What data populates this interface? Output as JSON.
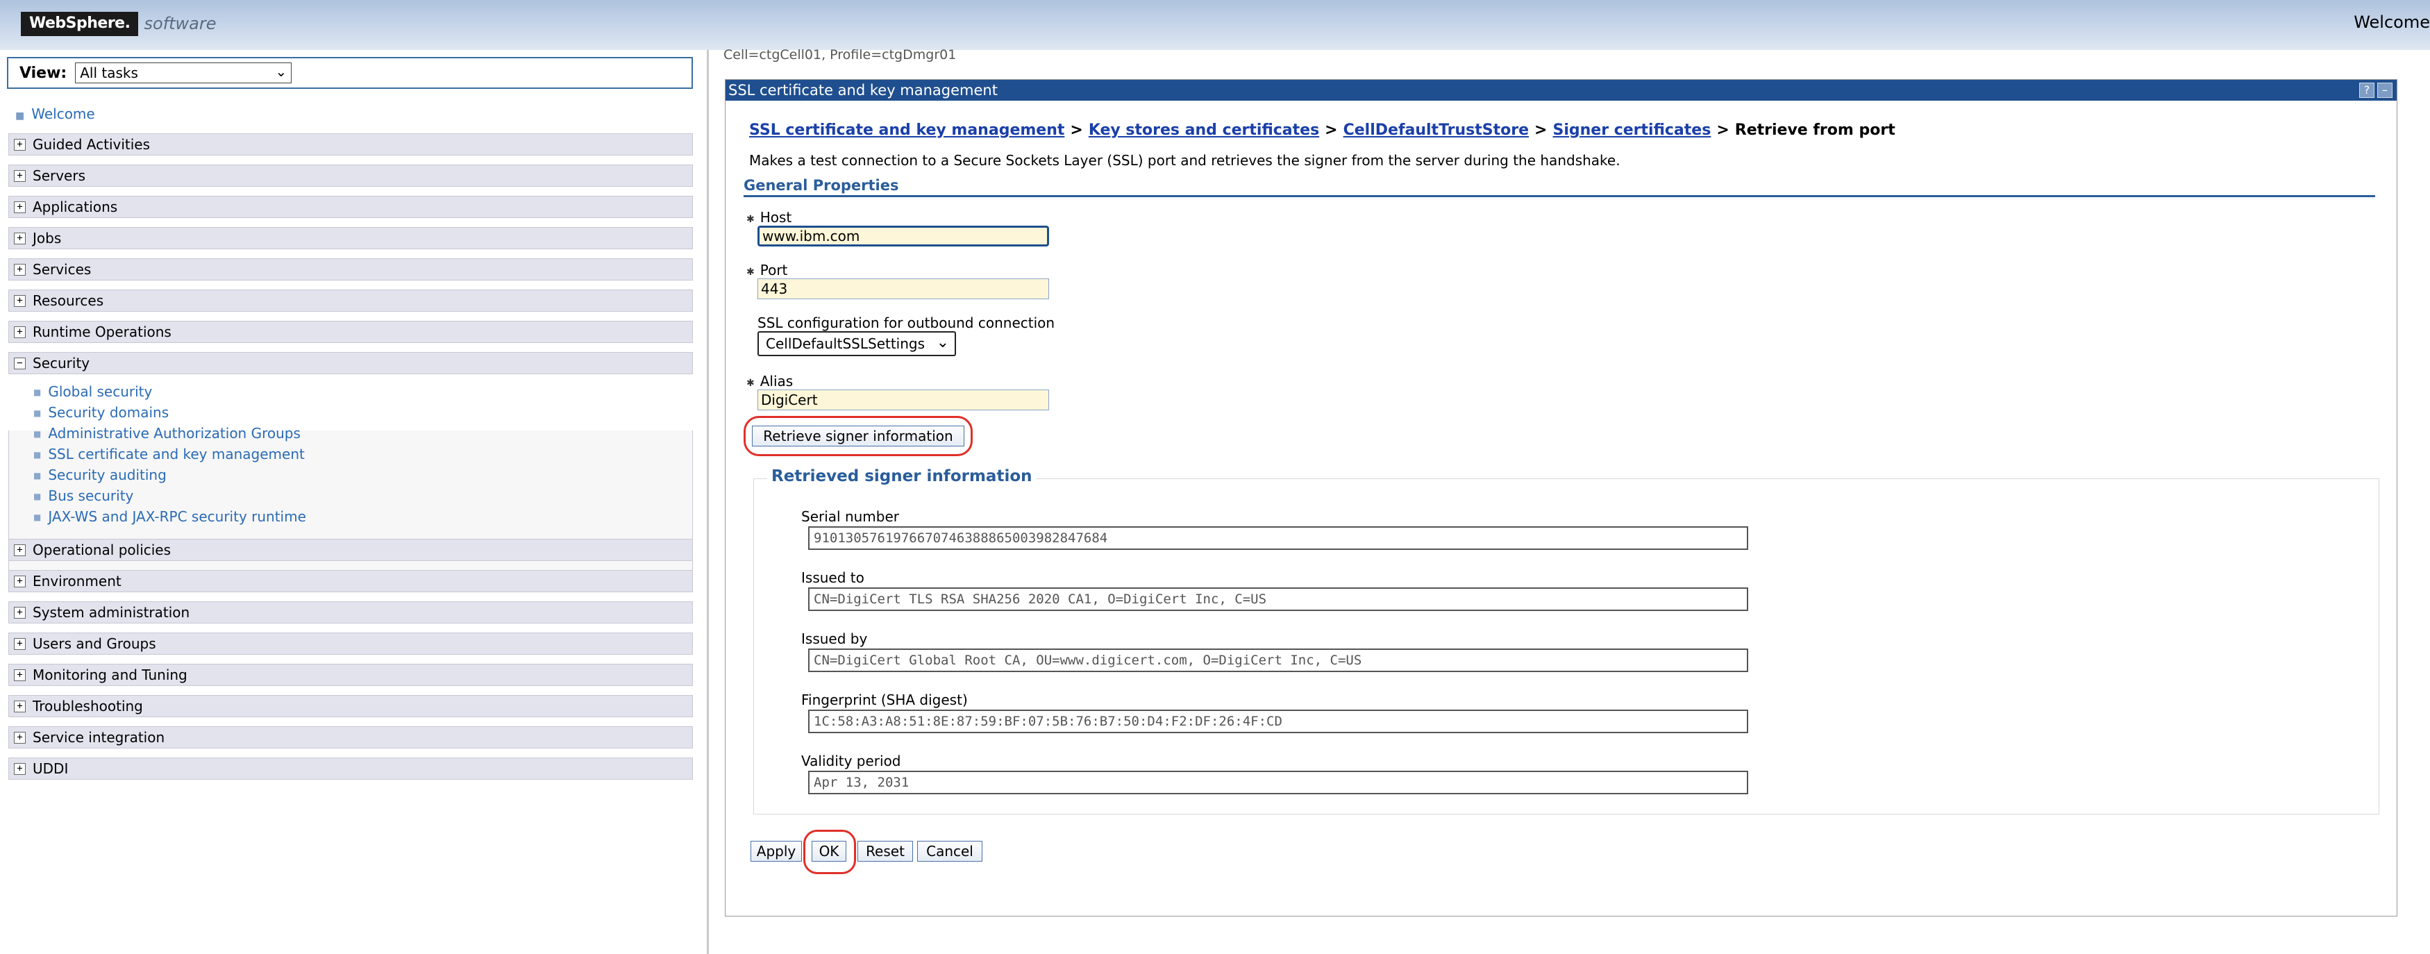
{
  "banner": {
    "logo_box": "WebSphere.",
    "logo_software": "software",
    "welcome": "Welcome"
  },
  "nav": {
    "view_label": "View:",
    "view_value": "All tasks",
    "welcome_link": "Welcome",
    "categories": [
      {
        "label": "Guided Activities",
        "state": "+"
      },
      {
        "label": "Servers",
        "state": "+"
      },
      {
        "label": "Applications",
        "state": "+"
      },
      {
        "label": "Jobs",
        "state": "+"
      },
      {
        "label": "Services",
        "state": "+"
      },
      {
        "label": "Resources",
        "state": "+"
      },
      {
        "label": "Runtime Operations",
        "state": "+"
      },
      {
        "label": "Security",
        "state": "−"
      },
      {
        "label": "Operational policies",
        "state": "+"
      },
      {
        "label": "Environment",
        "state": "+"
      },
      {
        "label": "System administration",
        "state": "+"
      },
      {
        "label": "Users and Groups",
        "state": "+"
      },
      {
        "label": "Monitoring and Tuning",
        "state": "+"
      },
      {
        "label": "Troubleshooting",
        "state": "+"
      },
      {
        "label": "Service integration",
        "state": "+"
      },
      {
        "label": "UDDI",
        "state": "+"
      }
    ],
    "security_items": [
      "Global security",
      "Security domains",
      "Administrative Authorization Groups",
      "SSL certificate and key management",
      "Security auditing",
      "Bus security",
      "JAX-WS and JAX-RPC security runtime"
    ]
  },
  "content": {
    "cell_line": "Cell=ctgCell01, Profile=ctgDmgr01",
    "panel_title": "SSL certificate and key management",
    "help_btn": "?",
    "min_btn": "–",
    "breadcrumb": {
      "link1": "SSL certificate and key management",
      "link2": "Key stores and certificates",
      "link3": "CellDefaultTrustStore",
      "link4": "Signer certificates",
      "sep": ">",
      "current": "Retrieve from port"
    },
    "description": "Makes a test connection to a Secure Sockets Layer (SSL) port and retrieves the signer from the server during the handshake.",
    "general_properties": "General Properties",
    "required_marker": "✱",
    "host_label": "Host",
    "host_value": "www.ibm.com",
    "port_label": "Port",
    "port_value": "443",
    "ssl_label": "SSL configuration for outbound connection",
    "ssl_value": "CellDefaultSSLSettings",
    "alias_label": "Alias",
    "alias_value": "DigiCert",
    "retrieve_button": "Retrieve signer information",
    "retrieved_title": "Retrieved signer information",
    "serial_label": "Serial number",
    "serial_value": "9101305761976670746388865003982847684",
    "issued_to_label": "Issued to",
    "issued_to_value": "CN=DigiCert TLS RSA SHA256 2020 CA1, O=DigiCert Inc, C=US",
    "issued_by_label": "Issued by",
    "issued_by_value": "CN=DigiCert Global Root CA, OU=www.digicert.com, O=DigiCert Inc, C=US",
    "fingerprint_label": "Fingerprint (SHA digest)",
    "fingerprint_value": "1C:58:A3:A8:51:8E:87:59:BF:07:5B:76:B7:50:D4:F2:DF:26:4F:CD",
    "validity_label": "Validity period",
    "validity_value": "Apr 13, 2031",
    "apply_button": "Apply",
    "ok_button": "OK",
    "reset_button": "Reset",
    "cancel_button": "Cancel"
  }
}
